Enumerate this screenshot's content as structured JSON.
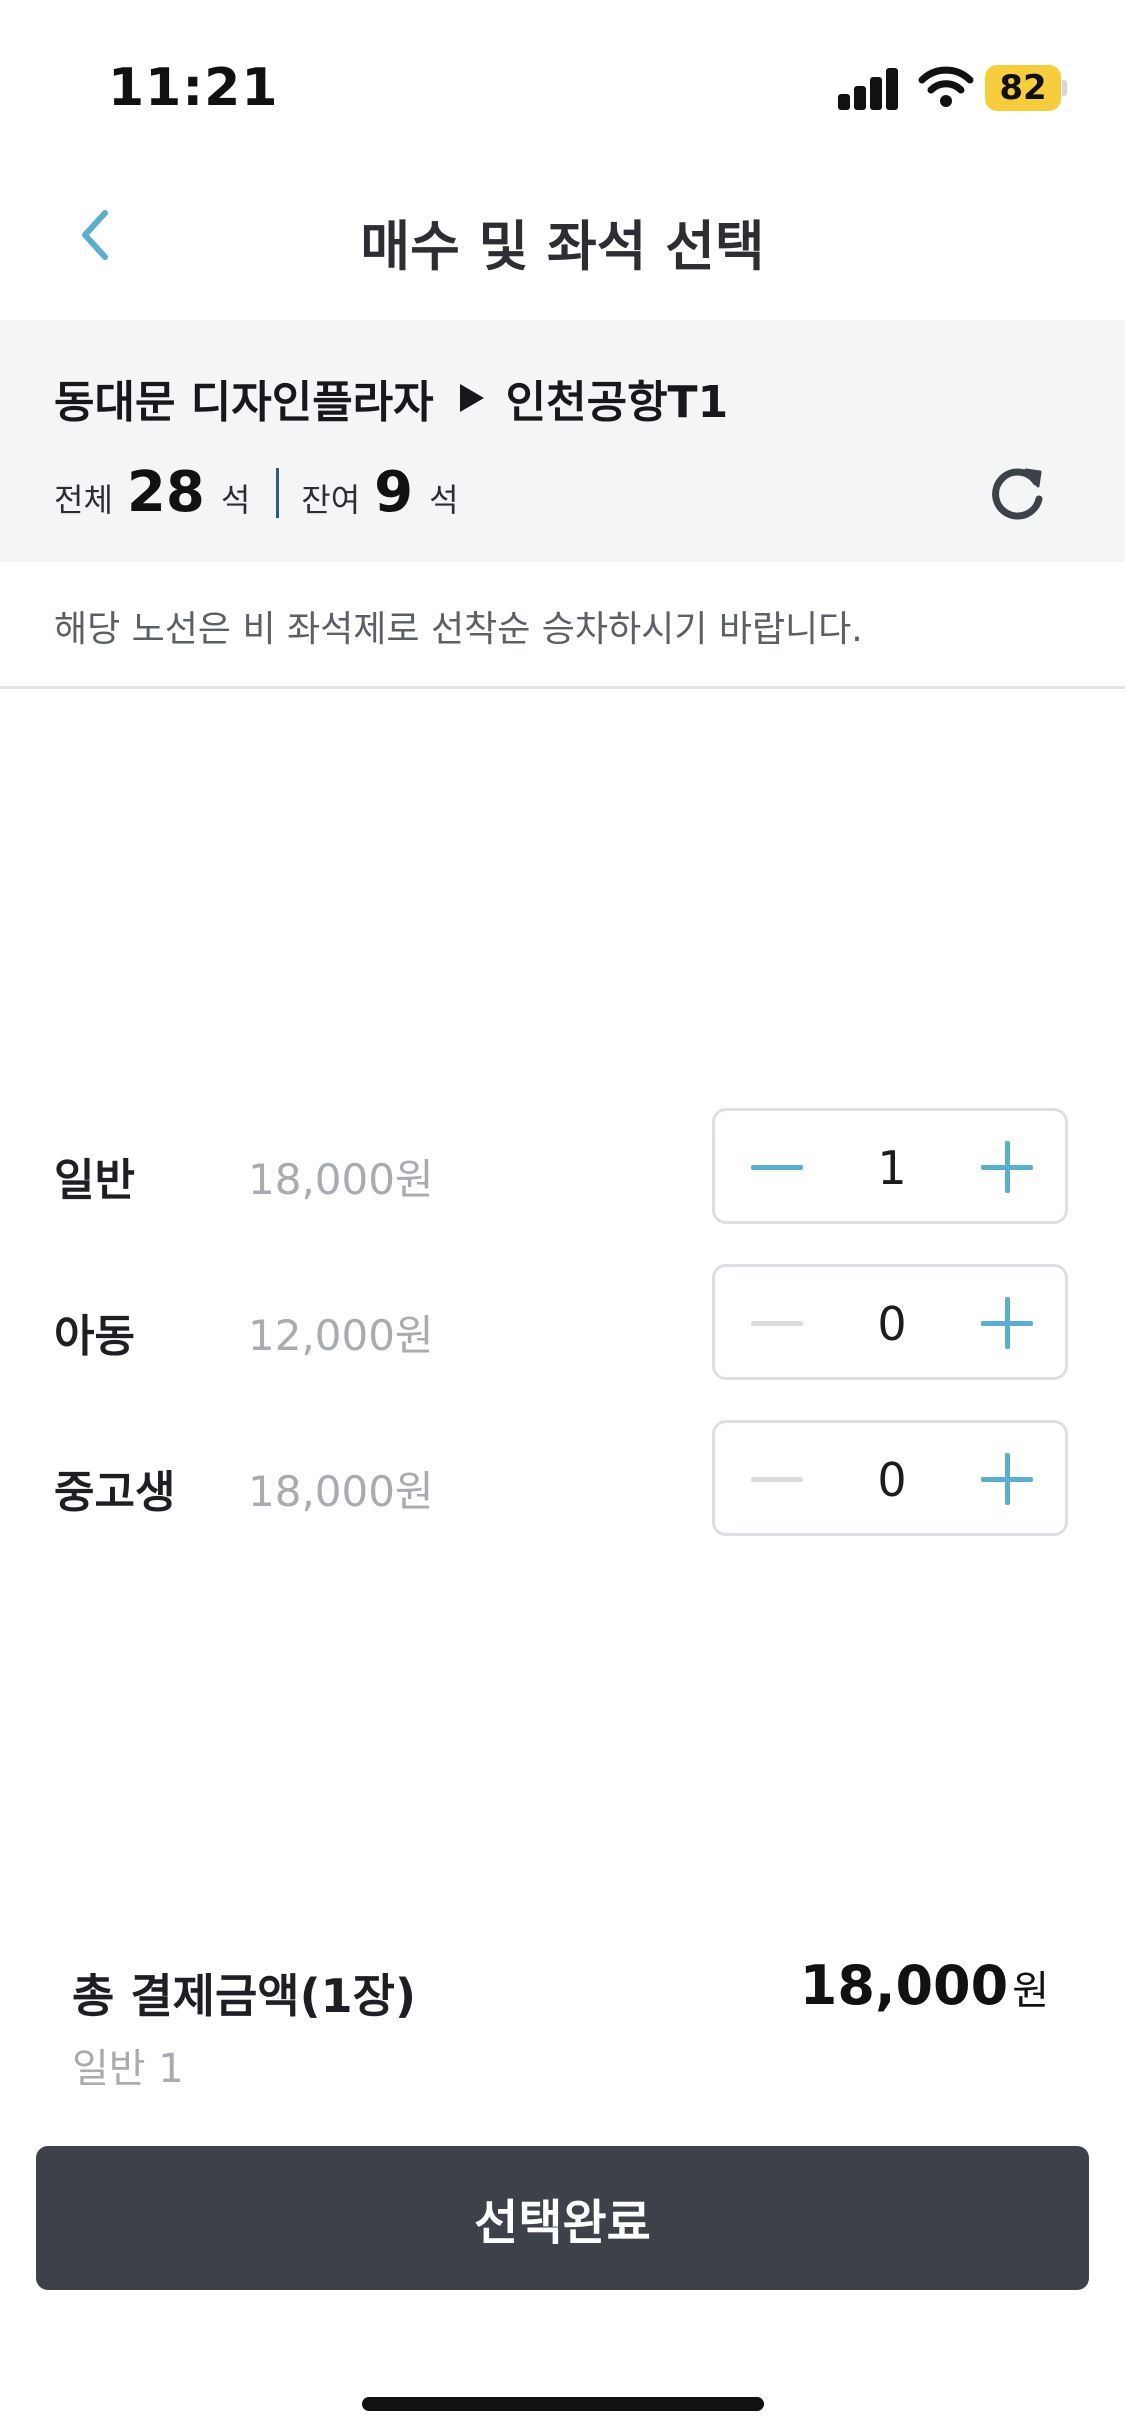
{
  "status_bar": {
    "time": "11:21",
    "battery": "82"
  },
  "header": {
    "title": "매수 및 좌석 선택"
  },
  "route": {
    "origin": "동대문 디자인플라자",
    "destination": "인천공항T1",
    "total_label": "전체",
    "total_seats": "28",
    "total_unit": "석",
    "remaining_label": "잔여",
    "remaining_seats": "9",
    "remaining_unit": "석"
  },
  "notice": "해당 노선은 비 좌석제로 선착순 승차하시기 바랍니다.",
  "passengers": [
    {
      "type": "일반",
      "price": "18,000원",
      "count": "1"
    },
    {
      "type": "아동",
      "price": "12,000원",
      "count": "0"
    },
    {
      "type": "중고생",
      "price": "18,000원",
      "count": "0"
    }
  ],
  "summary": {
    "label": "총 결제금액(1장)",
    "detail": "일반 1",
    "amount": "18,000",
    "unit": "원"
  },
  "confirm_button": "선택완료",
  "colors": {
    "accent": "#5aaece",
    "disabled": "#dcdcdc",
    "button_bg": "#3d4149",
    "panel_bg": "#f4f5f7",
    "battery": "#f6cd3c"
  }
}
